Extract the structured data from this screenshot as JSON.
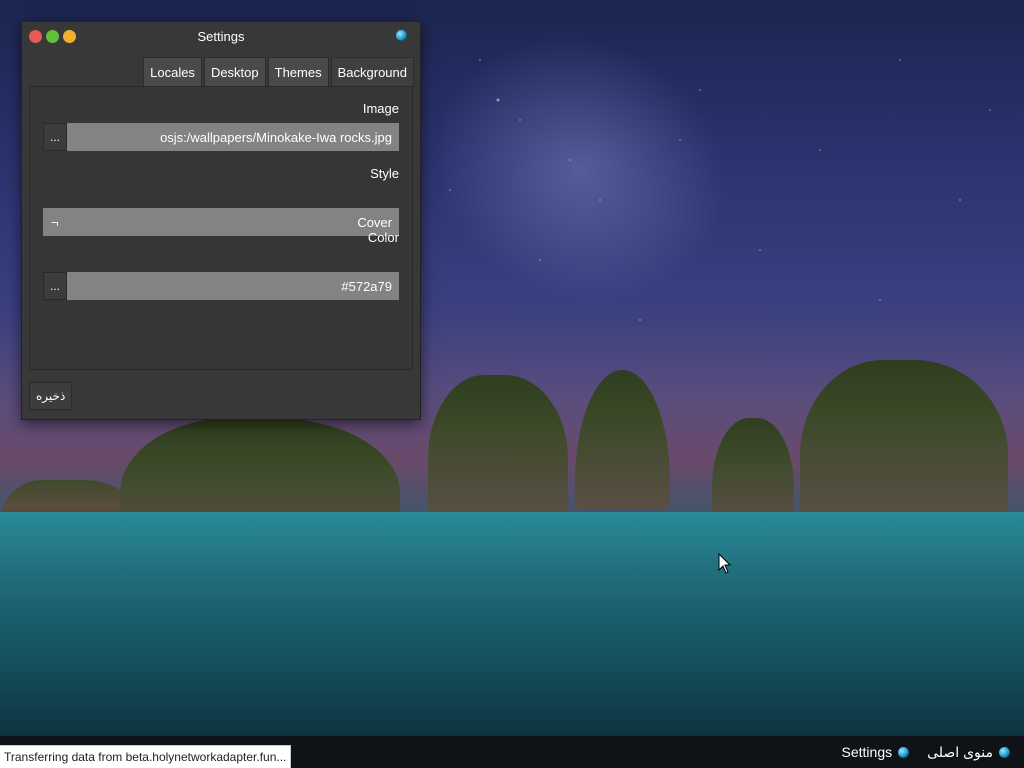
{
  "window": {
    "title": "Settings",
    "tabs": [
      {
        "label": "Locales"
      },
      {
        "label": "Desktop"
      },
      {
        "label": "Themes"
      },
      {
        "label": "Background"
      }
    ],
    "image": {
      "label": "Image",
      "browse": "...",
      "value": "osjs:/wallpapers/Minokake-Iwa rocks.jpg"
    },
    "style": {
      "label": "Style",
      "value": "Cover",
      "arrow": "¬"
    },
    "color": {
      "label": "Color",
      "browse": "...",
      "value": "#572a79"
    },
    "save_label": "ذخیره"
  },
  "taskbar": {
    "items": [
      {
        "label": "Settings",
        "icon": "globe-icon"
      },
      {
        "label": "منوی اصلی",
        "icon": "globe-icon"
      }
    ]
  },
  "status": {
    "text": "Transferring data from beta.holynetworkadapter.fun..."
  },
  "colors": {
    "window_bg": "#383838",
    "input_bg": "#838383",
    "close": "#e85a55",
    "maximize": "#5fc03a",
    "minimize": "#f2b12c"
  }
}
